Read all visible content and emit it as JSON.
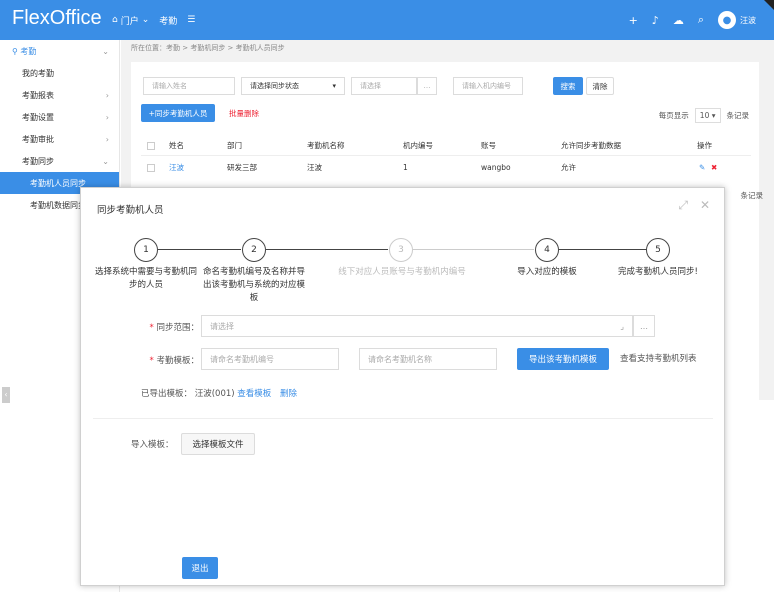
{
  "app": {
    "logo": "FlexOffice"
  },
  "topnav": {
    "portal": "门户",
    "attendance": "考勤",
    "menu_icon": "grid-icon"
  },
  "user": {
    "name": "汪波"
  },
  "sidebar": {
    "section": "考勤",
    "items": [
      {
        "label": "我的考勤"
      },
      {
        "label": "考勤报表"
      },
      {
        "label": "考勤设置"
      },
      {
        "label": "考勤审批"
      },
      {
        "label": "考勤同步"
      }
    ],
    "sub_items": [
      {
        "label": "考勤机人员同步"
      },
      {
        "label": "考勤机数据同步"
      }
    ]
  },
  "breadcrumb": "所在位置：考勤 > 考勤机同步 > 考勤机人员同步",
  "filters": {
    "name_placeholder": "请输入姓名",
    "status_select": "请选择同步状态",
    "select_placeholder": "请选择",
    "machine_placeholder": "请输入机内编号",
    "search": "搜索",
    "clear": "清除"
  },
  "actions": {
    "add": "+同步考勤机人员",
    "batch_delete": "批量删除"
  },
  "pager": {
    "per_page_label": "每页显示",
    "per_page": "10",
    "unit": "条记录"
  },
  "table": {
    "headers": [
      "姓名",
      "部门",
      "考勤机名称",
      "机内编号",
      "账号",
      "允许同步考勤数据",
      "操作"
    ],
    "rows": [
      {
        "name": "汪波",
        "dept": "研发三部",
        "machine": "汪波",
        "code": "1",
        "account": "wangbo",
        "allow": "允许"
      }
    ]
  },
  "dialog": {
    "title": "同步考勤机人员",
    "steps": [
      {
        "num": "1",
        "text": "选择系统中需要与考勤机同步的人员"
      },
      {
        "num": "2",
        "text": "命名考勤机编号及名称并导出该考勤机与系统的对应模板"
      },
      {
        "num": "3",
        "text": "线下对应人员账号与考勤机内编号"
      },
      {
        "num": "4",
        "text": "导入对应的模板"
      },
      {
        "num": "5",
        "text": "完成考勤机人员同步!"
      }
    ],
    "scope_label": "同步范围：",
    "scope_placeholder": "请选择",
    "template_label": "考勤模板：",
    "code_placeholder": "请命名考勤机编号",
    "name_placeholder": "请命名考勤机名称",
    "export_btn": "导出该考勤机模板",
    "view_list": "查看支持考勤机列表",
    "exported_label": "已导出模板：",
    "exported_value": "汪波(001)",
    "view_template": "查看模板",
    "delete": "删除",
    "import_label": "导入模板：",
    "choose_file": "选择模板文件",
    "exit": "退出"
  },
  "colors": {
    "primary": "#3a8ee6",
    "danger": "#ee2233"
  }
}
